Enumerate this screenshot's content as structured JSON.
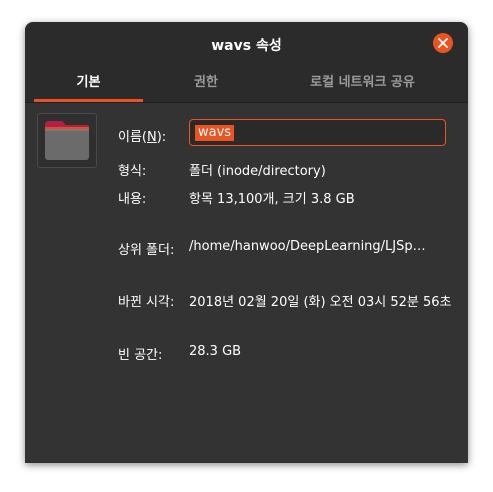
{
  "window": {
    "title": "wavs 속성",
    "close_icon": "close-icon",
    "accent_color": "#e95420"
  },
  "tabs": [
    {
      "label": "기본",
      "active": true
    },
    {
      "label": "권한",
      "active": false
    },
    {
      "label": "로컬 네트워크 공유",
      "active": false
    }
  ],
  "folder_icon": "folder-icon",
  "fields": {
    "name_label": "이름(N):",
    "name_value": "wavs",
    "type_label": "형식:",
    "type_value": "폴더 (inode/directory)",
    "contents_label": "내용:",
    "contents_value": "항목 13,100개, 크기 3.8 GB",
    "parent_label": "상위 폴더:",
    "parent_value": "/home/hanwoo/DeepLearning/LJSp…",
    "modified_label": "바뀐 시각:",
    "modified_value": "2018년 02월 20일 (화) 오전 03시 52분 56초",
    "free_label": "빈 공간:",
    "free_value": "28.3 GB"
  }
}
